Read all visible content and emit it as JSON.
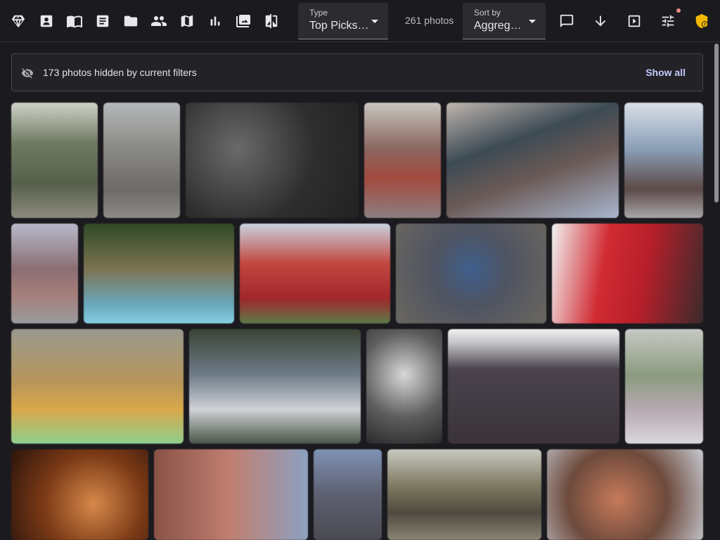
{
  "toolbar": {
    "icons": [
      "diamond-icon",
      "image-icon",
      "book-open-icon",
      "article-icon",
      "folder-icon",
      "people-icon",
      "map-icon",
      "bar-chart-icon",
      "photo-library-icon",
      "compare-icon"
    ],
    "type_select": {
      "label": "Type",
      "value": "Top Picks…"
    },
    "photo_count": "261 photos",
    "sort_select": {
      "label": "Sort by",
      "value": "Aggrega…"
    },
    "right_icons": [
      "comment-icon",
      "download-arrow-icon",
      "slideshow-play-icon",
      "tune-sliders-icon",
      "shield-icon"
    ]
  },
  "banner": {
    "text": "173 photos hidden by current filters",
    "action": "Show all",
    "icon": "visibility-off-icon"
  },
  "colors": {
    "background": "#1b1b1f",
    "link": "#c6cbff",
    "badge": "#f2b705"
  },
  "photos": [
    {
      "bg": "linear-gradient(180deg,#cfd3c8 0%,#6f7a62 35%,#56604b 70%,#8d8a7f 100%)"
    },
    {
      "bg": "linear-gradient(180deg,#b5b7b9 0%,#8a8985 40%,#6d6b68 75%,#8c8a86 100%)"
    },
    {
      "bg": "radial-gradient(circle at 30% 40%,#6a6a6a 0%,#2e2e2e 55%,#222 100%)"
    },
    {
      "bg": "linear-gradient(180deg,#c9c5c0 0%,#8a6660 40%,#a34a3e 65%,#8b7f80 100%)"
    },
    {
      "bg": "linear-gradient(160deg,#bfb5ae 0%,#3d4b55 35%,#6b5a56 60%,#a9b7cf 100%)"
    },
    {
      "bg": "linear-gradient(180deg,#d9dfe8 0%,#8b9fb7 40%,#5d4a48 75%,#a7a5a8 100%)"
    },
    {
      "bg": "linear-gradient(180deg,#b7b9c9 0%,#8a6f74 45%,#a57e78 70%,#9a9a9e 100%)"
    },
    {
      "bg": "linear-gradient(180deg,#2f4a27 0%,#7d7350 45%,#6aa6b9 80%,#84cfe2 100%)"
    },
    {
      "bg": "linear-gradient(180deg,#c8d3e0 0%,#c3463f 40%,#a1272c 75%,#5b7a48 100%)"
    },
    {
      "bg": "radial-gradient(circle at 50% 45%,#3e5f8c 0%,#4f5462 40%,#6b6760 100%)"
    },
    {
      "bg": "linear-gradient(100deg,#f2f2f2 0%,#d12b33 35%,#b81f2a 60%,#3b2b2d 100%)"
    },
    {
      "bg": "linear-gradient(180deg,#9a9a8e 0%,#b6955b 45%,#d9a84a 70%,#8fcf8e 100%)"
    },
    {
      "bg": "linear-gradient(180deg,#3a4333 0%,#6f7c89 40%,#cfd2d7 70%,#4a5446 100%)"
    },
    {
      "bg": "radial-gradient(circle at 50% 40%,#d8d8d8 0%,#5d5d5d 55%,#2a2a2a 100%)"
    },
    {
      "bg": "linear-gradient(180deg,#f2f2f2 0%,#c4c4c8 12%,#4a434d 35%,#3a3339 100%)"
    },
    {
      "bg": "linear-gradient(180deg,#c7c9c5 0%,#8b9b7f 40%,#b7a9b2 70%,#d9d7db 100%)"
    },
    {
      "bg": "radial-gradient(circle at 60% 60%,#d7894a 0%,#7c3a16 50%,#2a140c 100%)"
    },
    {
      "bg": "linear-gradient(90deg,#8a5246 0%,#c07f72 50%,#8ca1c1 100%)"
    },
    {
      "bg": "linear-gradient(180deg,#7f93b4 0%,#5d6070 50%,#4a4a52 100%)"
    },
    {
      "bg": "linear-gradient(180deg,#c9c9c0 0%,#7e7a62 40%,#4f4a40 70%,#8a8474 100%)"
    },
    {
      "bg": "radial-gradient(circle at 45% 55%,#c77a5a 0%,#6d4a3c 50%,#c7cad2 100%)"
    }
  ]
}
